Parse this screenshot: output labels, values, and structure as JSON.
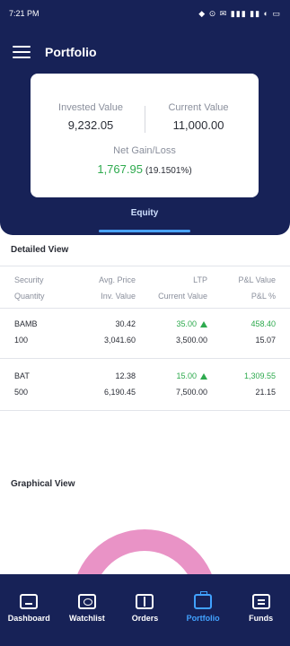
{
  "status_bar": {
    "time": "7:21 PM",
    "icons": "◆ ⊙ ✉ ▮▮▮ ▮▮ ◐ ▭"
  },
  "app": {
    "title": "Portfolio"
  },
  "summary": {
    "invested_label": "Invested Value",
    "invested_value": "9,232.05",
    "current_label": "Current Value",
    "current_value": "11,000.00",
    "gain_label": "Net Gain/Loss",
    "gain_value": "1,767.95",
    "gain_percent": "(19.1501%)"
  },
  "tabs": {
    "equity": "Equity"
  },
  "detailed": {
    "title": "Detailed View",
    "headers": {
      "col1_line1": "Security",
      "col1_line2": "Quantity",
      "col2_line1": "Avg. Price",
      "col2_line2": "Inv. Value",
      "col3_line1": "LTP",
      "col3_line2": "Current Value",
      "col4_line1": "P&L Value",
      "col4_line2": "P&L %"
    },
    "rows": [
      {
        "security": "BAMB",
        "quantity": "100",
        "avg_price": "30.42",
        "inv_value": "3,041.60",
        "ltp": "35.00",
        "current_value": "3,500.00",
        "pl_value": "458.40",
        "pl_pct": "15.07"
      },
      {
        "security": "BAT",
        "quantity": "500",
        "avg_price": "12.38",
        "inv_value": "6,190.45",
        "ltp": "15.00",
        "current_value": "7,500.00",
        "pl_value": "1,309.55",
        "pl_pct": "21.15"
      }
    ]
  },
  "graphical": {
    "title": "Graphical View"
  },
  "colors": {
    "navy": "#172257",
    "accent": "#41a2ff",
    "gain": "#2eaa4e",
    "donut": "#e993c6"
  },
  "bottom_nav": [
    {
      "label": "Dashboard",
      "icon": "monitor-icon"
    },
    {
      "label": "Watchlist",
      "icon": "watchlist-icon"
    },
    {
      "label": "Orders",
      "icon": "orders-icon"
    },
    {
      "label": "Portfolio",
      "icon": "briefcase-icon",
      "active": true
    },
    {
      "label": "Funds",
      "icon": "wallet-icon"
    }
  ]
}
